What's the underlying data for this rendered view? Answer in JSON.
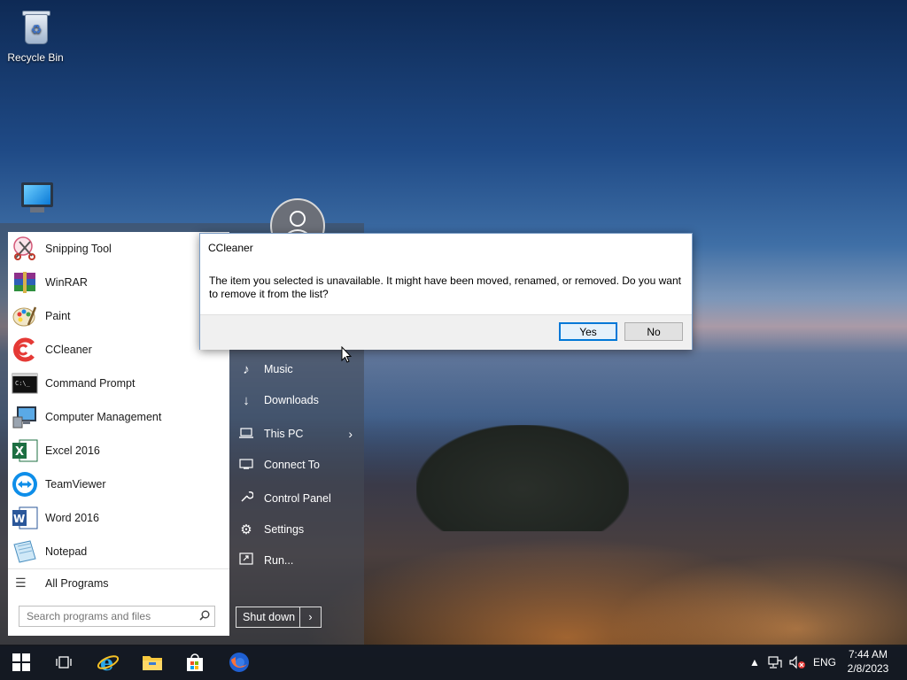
{
  "desktop": {
    "recycle_bin_label": "Recycle Bin"
  },
  "start_menu": {
    "programs": [
      {
        "label": "Snipping Tool",
        "icon": "snipping-tool-icon"
      },
      {
        "label": "WinRAR",
        "icon": "winrar-icon"
      },
      {
        "label": "Paint",
        "icon": "paint-icon"
      },
      {
        "label": "CCleaner",
        "icon": "ccleaner-icon"
      },
      {
        "label": "Command Prompt",
        "icon": "command-prompt-icon"
      },
      {
        "label": "Computer Management",
        "icon": "computer-management-icon"
      },
      {
        "label": "Excel 2016",
        "icon": "excel-icon"
      },
      {
        "label": "TeamViewer",
        "icon": "teamviewer-icon"
      },
      {
        "label": "Word 2016",
        "icon": "word-icon"
      },
      {
        "label": "Notepad",
        "icon": "notepad-icon"
      }
    ],
    "all_programs_label": "All Programs",
    "search_placeholder": "Search programs and files",
    "right_items": [
      {
        "label": "Music",
        "icon": "music-note-icon"
      },
      {
        "label": "Downloads",
        "icon": "download-arrow-icon"
      },
      {
        "label": "This PC",
        "icon": "laptop-icon"
      },
      {
        "label": "Connect To",
        "icon": "connect-icon"
      },
      {
        "label": "Control Panel",
        "icon": "wrench-icon"
      },
      {
        "label": "Settings",
        "icon": "gear-icon"
      },
      {
        "label": "Run...",
        "icon": "run-icon"
      }
    ],
    "shutdown_label": "Shut down",
    "shutdown_arrow": "›",
    "this_pc_arrow": "›"
  },
  "dialog": {
    "title": "CCleaner",
    "message": "The item you selected is unavailable.  It might have been moved, renamed, or removed.  Do you want to remove it from the list?",
    "yes_label": "Yes",
    "no_label": "No"
  },
  "taskbar": {
    "tray_language": "ENG",
    "tray_chevron": "▲",
    "clock_time": "7:44 AM",
    "clock_date": "2/8/2023"
  },
  "colors": {
    "accent": "#0078d7",
    "taskbar_bg": "#14181f"
  }
}
